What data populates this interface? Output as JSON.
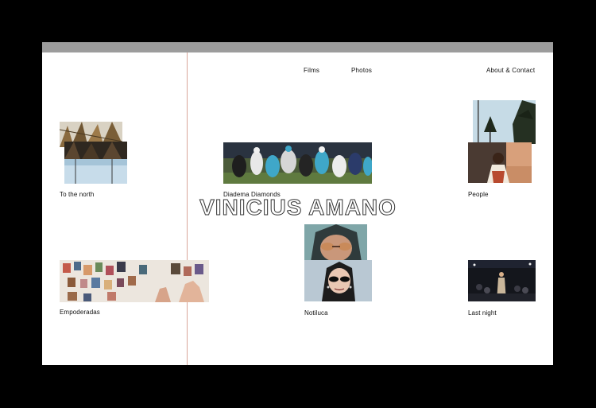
{
  "nav": {
    "films": "Films",
    "photos": "Photos",
    "about": "About & Contact"
  },
  "site_title": "VINICIUS AMANO",
  "projects": [
    {
      "label": "To the north",
      "thumbnail": "palm-fronds-and-sky photos"
    },
    {
      "label": "Diadema Diamonds",
      "thumbnail": "american-football-game photo"
    },
    {
      "label": "People",
      "thumbnail": "palm-trees and portrait photos"
    },
    {
      "label": "Empoderadas",
      "thumbnail": "collage-of-printed-photos"
    },
    {
      "label": "Notiluca",
      "thumbnail": "portraits-with-sunglasses"
    },
    {
      "label": "Last night",
      "thumbnail": "nightlife-event photo"
    }
  ],
  "colors": {
    "background": "#000000",
    "page": "#ffffff",
    "titlebar": "#9c9c9c",
    "guide_line": "#d9a79a"
  }
}
